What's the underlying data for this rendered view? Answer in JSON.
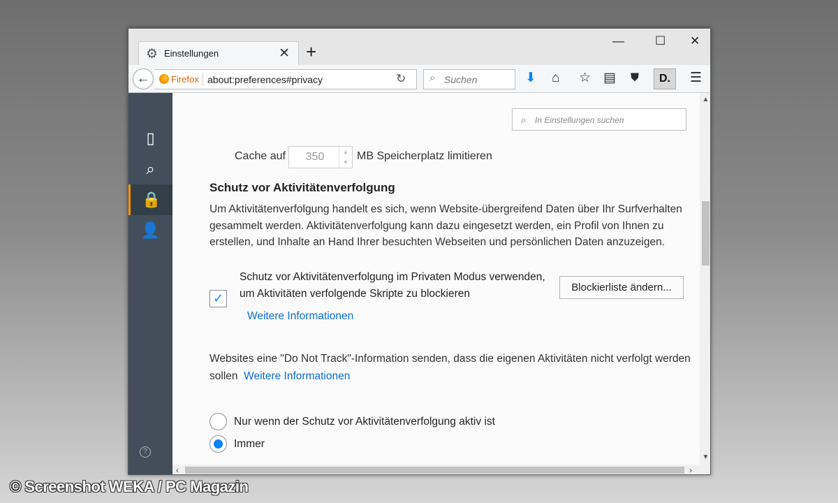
{
  "tab": {
    "title": "Einstellungen"
  },
  "toolbar": {
    "firefox_label": "Firefox",
    "url": "about:preferences#privacy",
    "search_placeholder": "Suchen",
    "profile_badge": "D."
  },
  "find": {
    "placeholder": "In Einstellungen suchen"
  },
  "cache": {
    "prefix": "Cache auf",
    "value": "350",
    "suffix": "MB Speicherplatz limitieren"
  },
  "tracking": {
    "heading": "Schutz vor Aktivitätenverfolgung",
    "description": "Um Aktivitätenverfolgung handelt es sich, wenn Website-übergreifend Daten über Ihr Surfverhalten gesammelt werden. Aktivitätenverfolgung kann dazu eingesetzt werden, ein Profil von Ihnen zu erstellen, und Inhalte an Hand Ihrer besuchten Webseiten und persönlichen Daten anzuzeigen.",
    "checkbox_label": "Schutz vor Aktivitätenverfolgung im Privaten Modus verwenden, um Aktivitäten verfolgende Skripte zu blockieren",
    "checkbox_checked": true,
    "more_info": "Weitere Informationen",
    "block_list_button": "Blockierliste ändern..."
  },
  "dnt": {
    "text": "Websites eine \"Do Not Track\"-Information senden, dass die eigenen Aktivitäten nicht verfolgt werden sollen",
    "more_info": "Weitere Informationen",
    "options": [
      {
        "label": "Nur wenn der Schutz vor Aktivitätenverfolgung aktiv ist",
        "checked": false
      },
      {
        "label": "Immer",
        "checked": true
      }
    ]
  },
  "sidebar": {
    "items": [
      {
        "icon": "general-icon"
      },
      {
        "icon": "search-icon"
      },
      {
        "icon": "privacy-lock-icon",
        "active": true
      },
      {
        "icon": "account-icon"
      }
    ]
  },
  "watermark": "© Screenshot WEKA / PC Magazin"
}
